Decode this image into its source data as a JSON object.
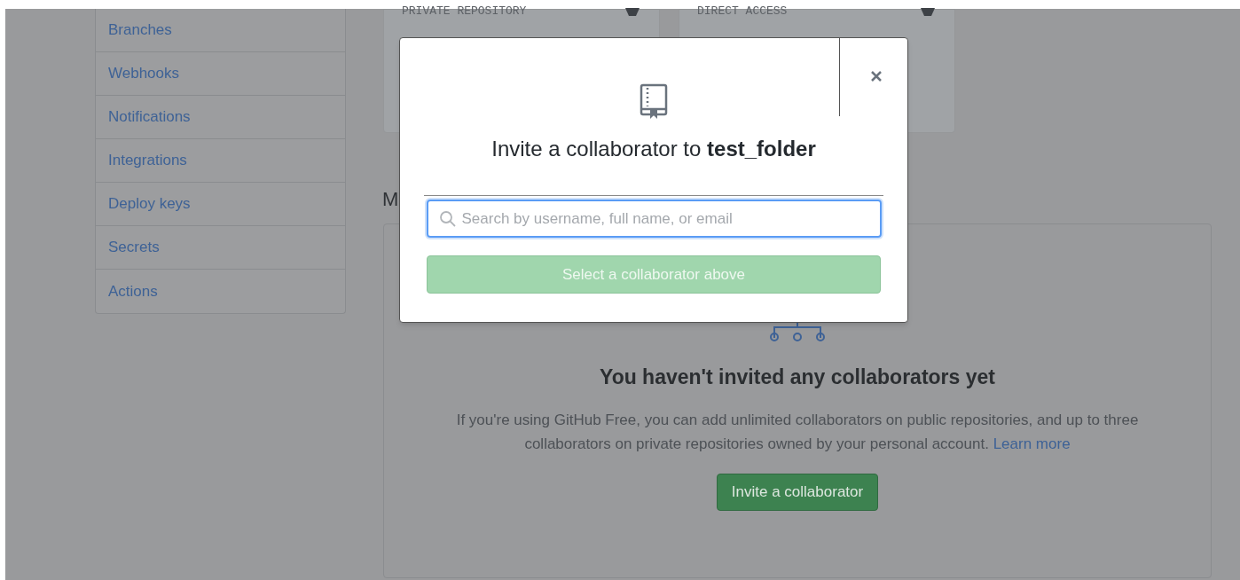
{
  "sidebar": {
    "items": [
      {
        "label": "Branches"
      },
      {
        "label": "Webhooks"
      },
      {
        "label": "Notifications"
      },
      {
        "label": "Integrations"
      },
      {
        "label": "Deploy keys"
      },
      {
        "label": "Secrets"
      },
      {
        "label": "Actions"
      }
    ]
  },
  "cards": [
    {
      "label": "PRIVATE REPOSITORY"
    },
    {
      "label": "DIRECT ACCESS"
    }
  ],
  "section_heading": "M",
  "empty_state": {
    "title": "You haven't invited any collaborators yet",
    "text": "If you're using GitHub Free, you can add unlimited collaborators on public repositories, and up to three collaborators on private repositories owned by your personal account.",
    "link": "Learn more",
    "button": "Invite a collaborator"
  },
  "modal": {
    "title": "Invite a collaborator to **test_folder**",
    "search": {
      "placeholder": "Search by username, full name, or email"
    },
    "submit": {
      "label": "Select a collaborator above",
      "disabled": true
    }
  }
}
